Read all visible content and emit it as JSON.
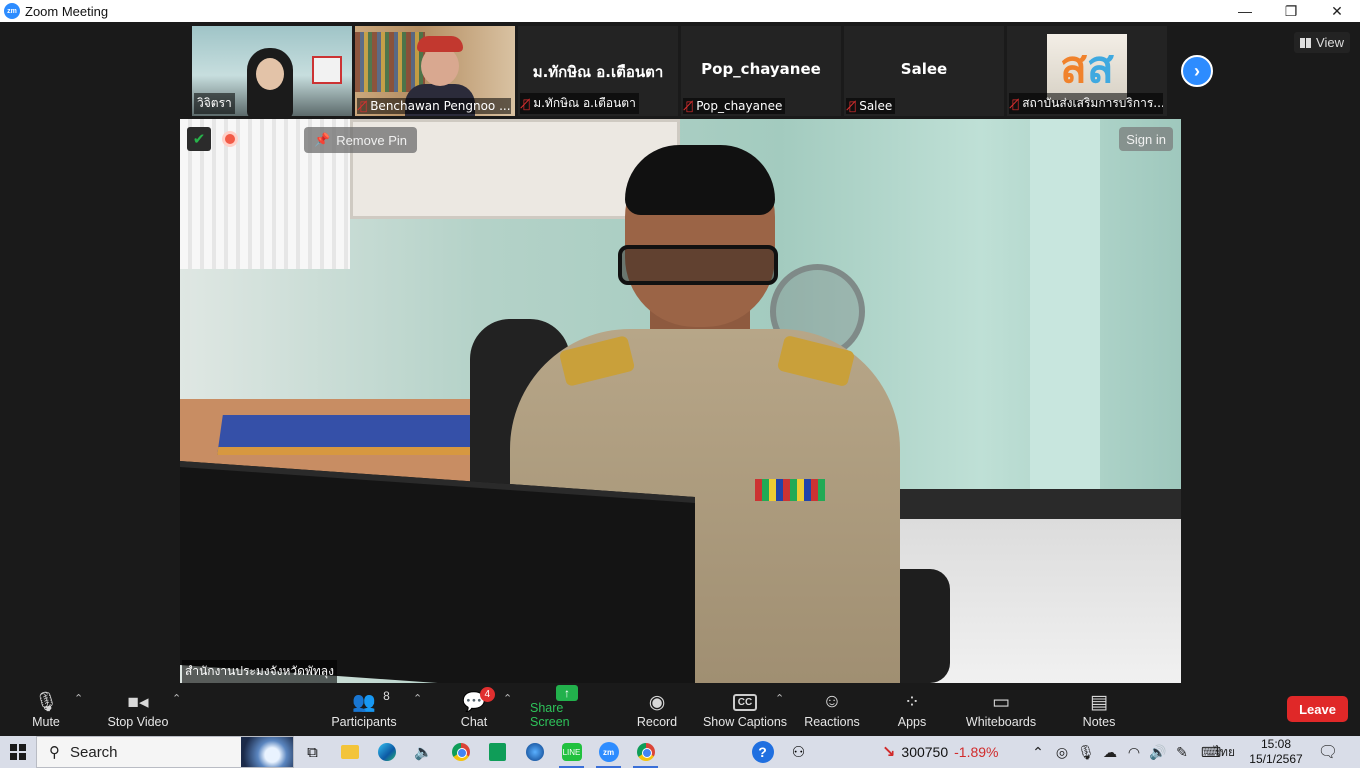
{
  "window": {
    "title": "Zoom Meeting",
    "logo_text": "zm",
    "controls": {
      "minimize": "—",
      "restore": "❐",
      "close": "✕"
    }
  },
  "view_button": {
    "label": "View"
  },
  "participants_strip": [
    {
      "name": "วิจิตรา",
      "muted": false,
      "has_video": true
    },
    {
      "name": "Benchawan Pengnoo ...",
      "muted": true,
      "has_video": true
    },
    {
      "name": "ม.ทักษิณ อ.เตือนตา",
      "display": "ม.ทักษิณ อ.เตือนตา",
      "muted": true,
      "has_video": false
    },
    {
      "name": "Pop_chayanee",
      "display": "Pop_chayanee",
      "muted": true,
      "has_video": false
    },
    {
      "name": "Salee",
      "display": "Salee",
      "muted": true,
      "has_video": false
    },
    {
      "name": "สถาบันส่งเสริมการบริการ...",
      "logo_text_a": "ส",
      "logo_text_b": "ส",
      "muted": true,
      "has_video": true
    }
  ],
  "main_video": {
    "remove_pin": "Remove Pin",
    "sign_in": "Sign in",
    "speaker_label": "สำนักงานประมงจังหวัดพัทลุง"
  },
  "toolbar": {
    "mute": "Mute",
    "stop_video": "Stop Video",
    "participants": "Participants",
    "participants_count": "8",
    "chat": "Chat",
    "chat_badge": "4",
    "share_screen": "Share Screen",
    "record": "Record",
    "show_captions": "Show Captions",
    "captions_icon_text": "CC",
    "reactions": "Reactions",
    "apps": "Apps",
    "whiteboards": "Whiteboards",
    "notes": "Notes",
    "leave": "Leave"
  },
  "taskbar": {
    "search_label": "Search",
    "zoom_icon_text": "zm",
    "line_icon_text": "LINE",
    "help_icon_text": "?",
    "stock_value": "300750",
    "stock_change": "-1.89%",
    "language": "ไทย",
    "time": "15:08",
    "date": "15/1/2567"
  },
  "colors": {
    "accent_blue": "#2d8cff",
    "share_green": "#22b14c",
    "leave_red": "#e02828",
    "muted_red": "#e02f2f"
  }
}
